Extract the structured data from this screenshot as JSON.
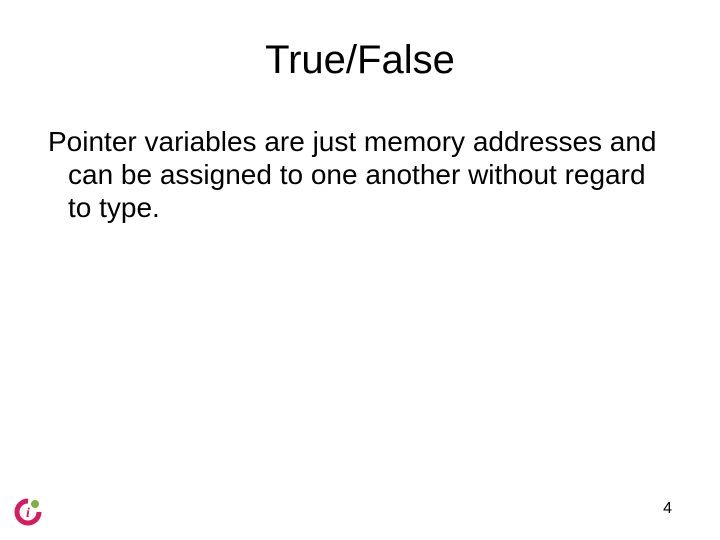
{
  "slide": {
    "title": "True/False",
    "body": "Pointer variables are just memory addresses and can be assigned to one another without regard to type.",
    "page_number": "4"
  },
  "logo": {
    "name": "info-icon",
    "colors": {
      "ring": "#d81b60",
      "dot": "#7cb342"
    }
  }
}
